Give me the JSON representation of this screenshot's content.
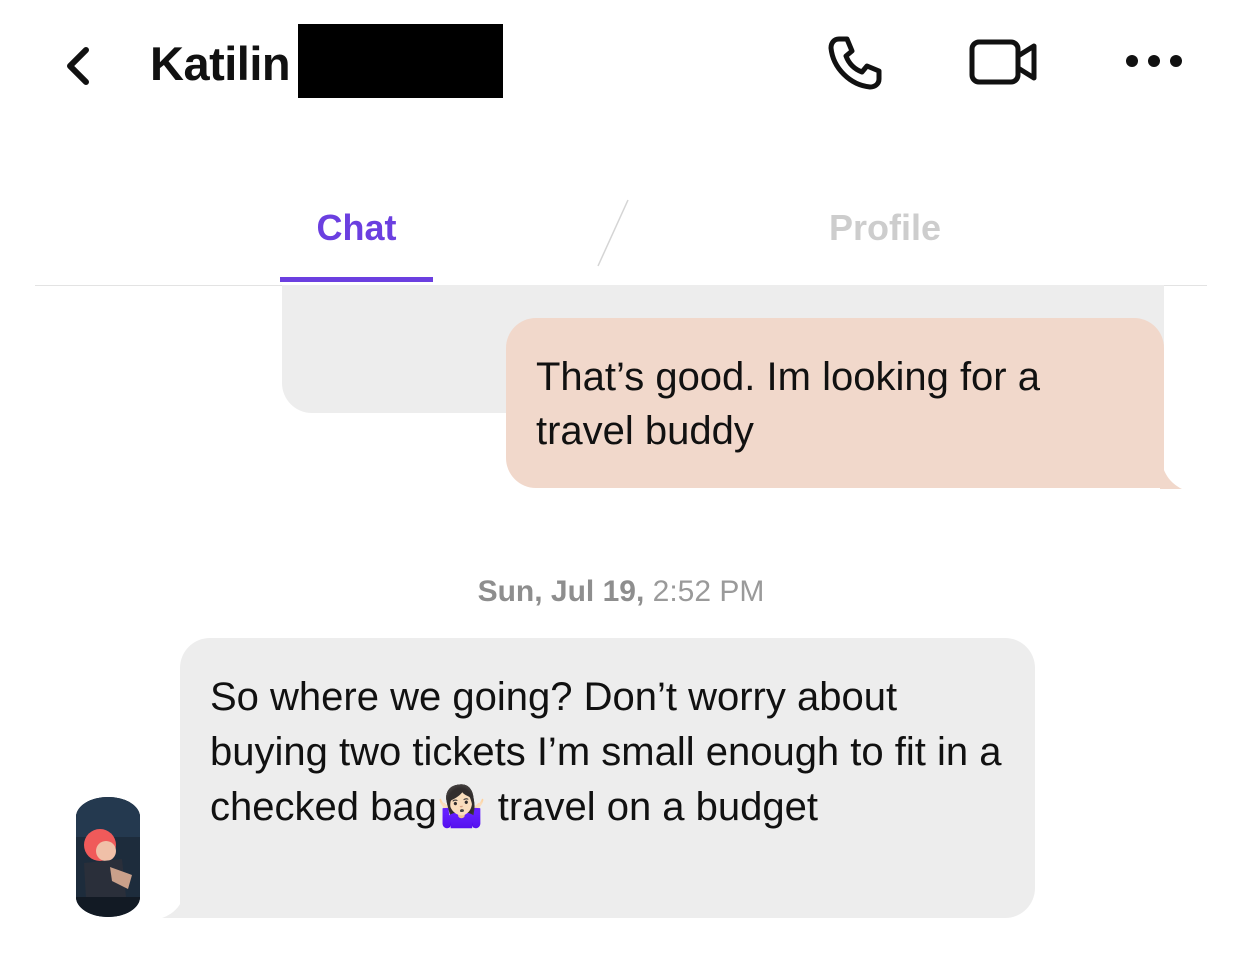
{
  "header": {
    "title": "Katilin",
    "back_icon": "chevron-left-icon",
    "phone_icon": "phone-icon",
    "video_icon": "video-camera-icon",
    "more_icon": "more-horizontal-icon"
  },
  "tabs": [
    {
      "label": "Chat",
      "active": true
    },
    {
      "label": "Profile",
      "active": false
    }
  ],
  "colors": {
    "accent": "#6b3fe0",
    "outgoing_bubble": "#f1d8cb",
    "incoming_bubble": "#ededed",
    "inactive_tab": "#cdcdcd"
  },
  "messages": {
    "outgoing": {
      "text": "That’s good.  Im looking for a travel buddy"
    },
    "timestamp": {
      "day": "Sun, Jul 19,",
      "time": "2:52 PM"
    },
    "incoming": {
      "text_before": "So where we going? Don’t worry about buying two tickets I’m small enough to fit in a checked bag",
      "emoji": "🤷🏻‍♀️",
      "text_after": " travel on a budget"
    }
  }
}
